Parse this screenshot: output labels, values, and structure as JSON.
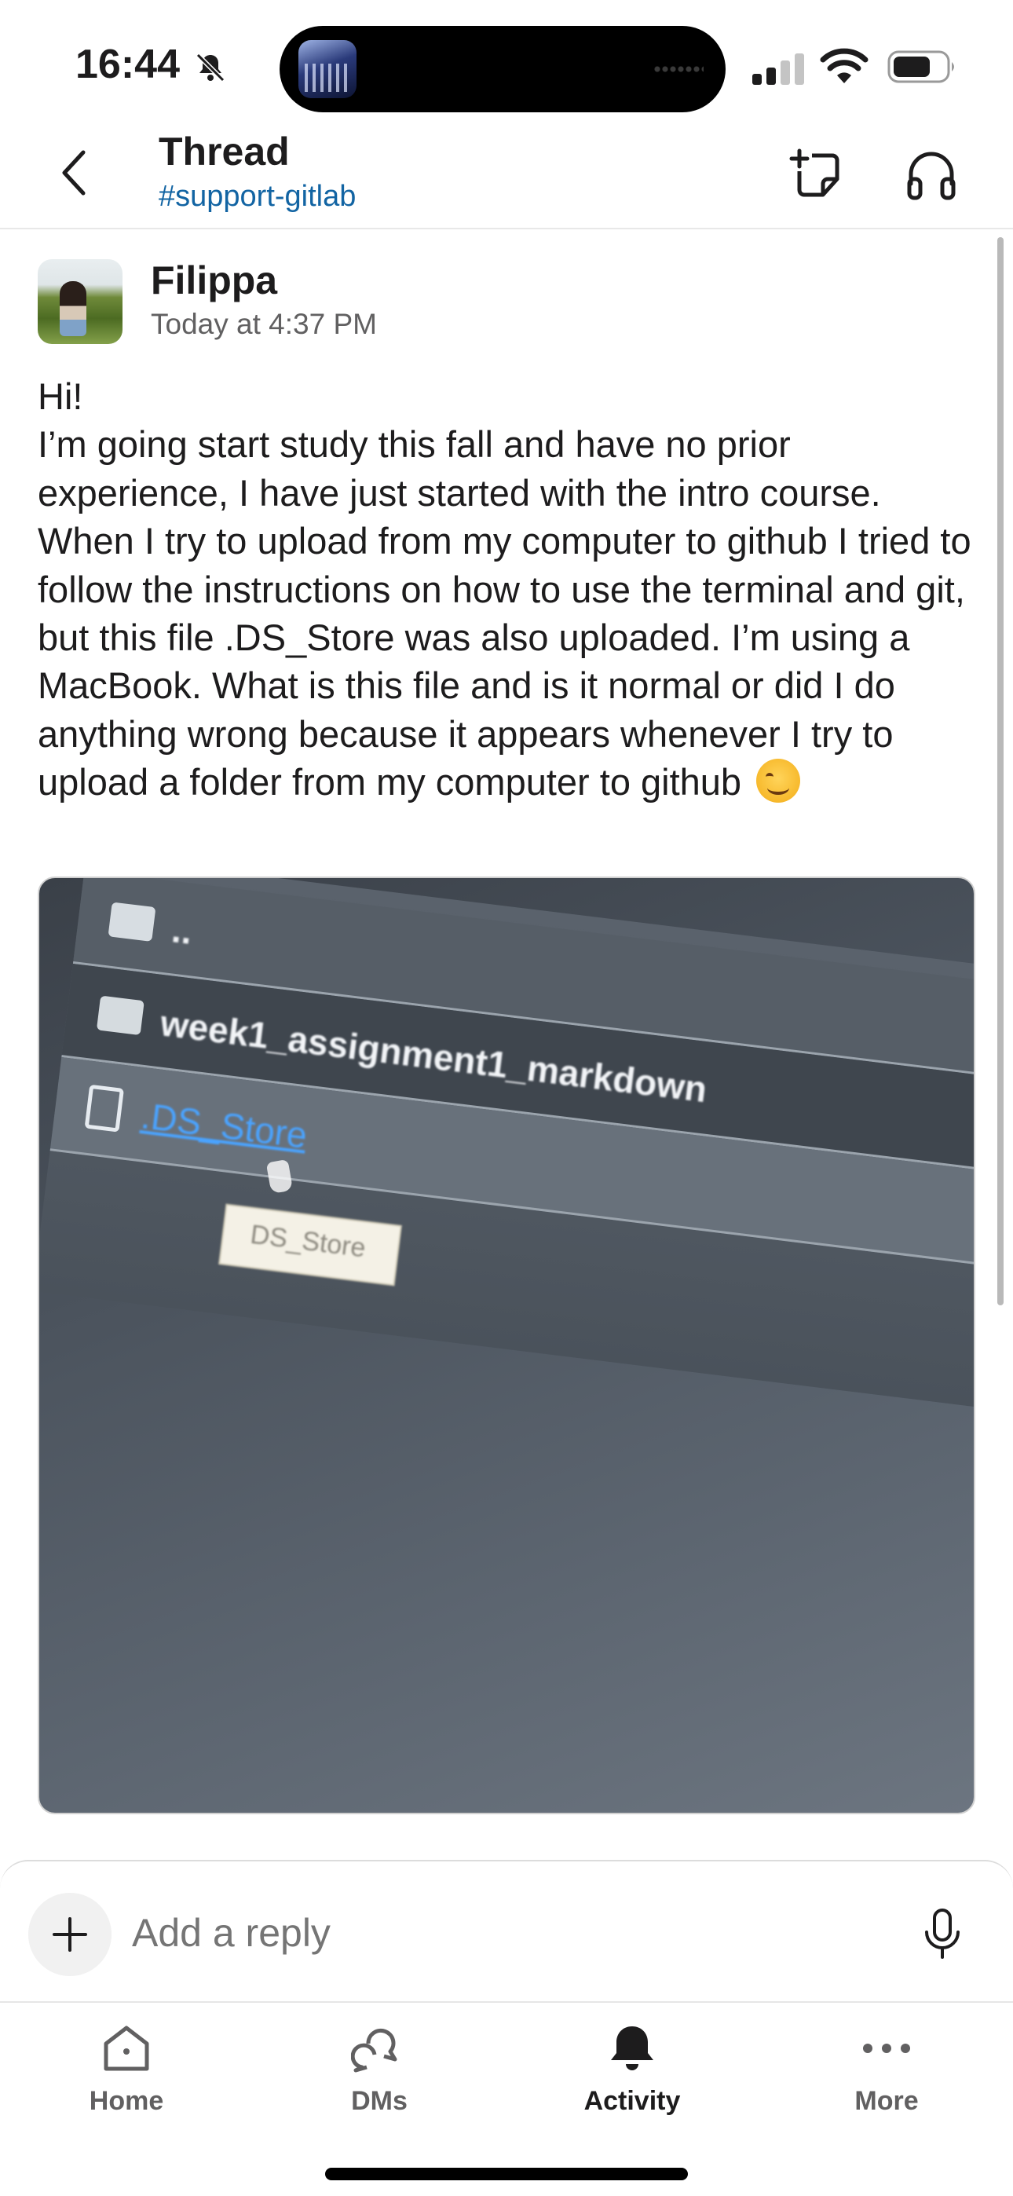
{
  "status_bar": {
    "time": "16:44",
    "icons": [
      "bell-slash-icon",
      "cellular-signal-icon",
      "wifi-icon",
      "battery-icon"
    ]
  },
  "header": {
    "title": "Thread",
    "channel": "#support-gitlab",
    "icons": [
      "back-chevron-icon",
      "new-note-icon",
      "headphones-icon"
    ]
  },
  "message": {
    "author": "Filippa",
    "timestamp": "Today at 4:37 PM",
    "greeting": "Hi!",
    "body": "I’m going start study this fall and have no prior experience, I have just started with the intro course. When I try to upload from my computer to github I tried to follow the instructions on how to use the terminal and git, but this file .DS_Store was also uploaded. I’m using a MacBook. What is this file and is it normal or did I do anything wrong because it appears whenever I try to upload a folder from my computer to github",
    "emoji": "smiling-face-emoji",
    "attachment": {
      "rows": [
        "..",
        "week1_assignment1_markdown",
        ".DS_Store"
      ],
      "tooltip": "DS_Store"
    }
  },
  "composer": {
    "placeholder": "Add a reply"
  },
  "tabs": [
    {
      "label": "Home",
      "icon": "home-icon"
    },
    {
      "label": "DMs",
      "icon": "dms-icon"
    },
    {
      "label": "Activity",
      "icon": "bell-icon",
      "active": true
    },
    {
      "label": "More",
      "icon": "more-dots-icon"
    }
  ]
}
